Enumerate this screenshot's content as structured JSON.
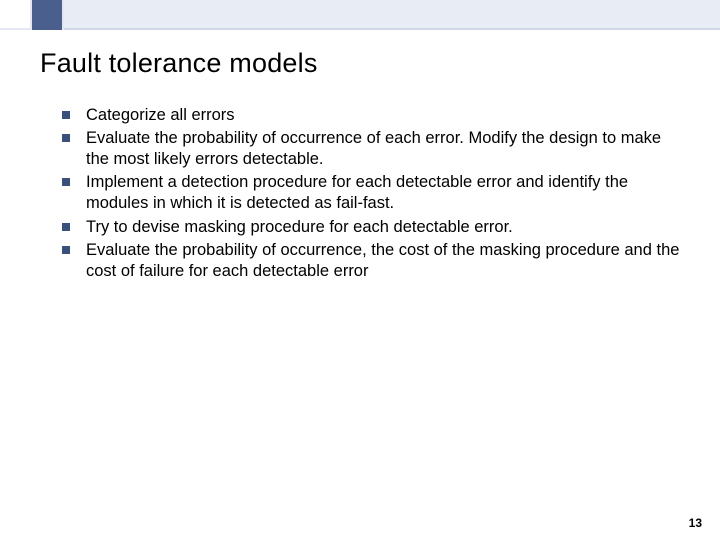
{
  "slide": {
    "title": "Fault tolerance models",
    "bullets": [
      "Categorize all errors",
      "Evaluate the probability of occurrence of each error. Modify the design to make the most likely errors detectable.",
      "Implement a detection procedure for each detectable error and identify the modules in which it is detected as fail-fast.",
      "Try to devise masking procedure for each detectable error.",
      "Evaluate the probability of occurrence, the cost of the masking procedure and the cost of failure for each detectable error"
    ],
    "page_number": "13"
  }
}
